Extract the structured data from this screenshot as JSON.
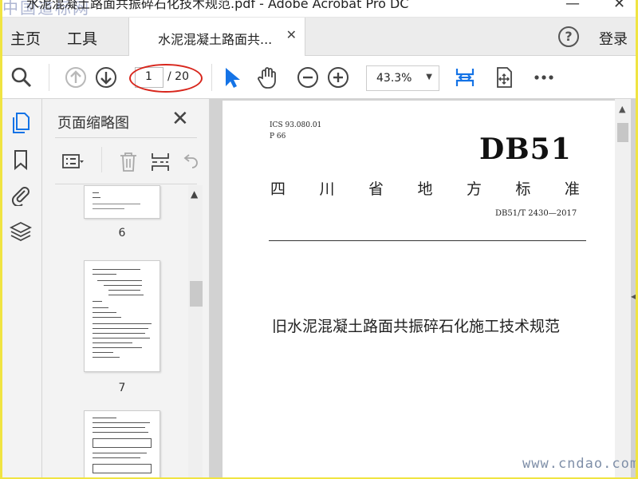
{
  "titlebar": {
    "title": "水泥混凝土路面共振碎石化技术规范.pdf - Adobe Acrobat Pro DC",
    "site_watermark": "中国道标网",
    "minimize_glyph": "—",
    "close_glyph": "✕"
  },
  "nav": {
    "home": "主页",
    "tools": "工具",
    "doc_tab_label": "水泥混凝土路面共...",
    "doc_tab_close": "✕",
    "help_glyph": "?",
    "login": "登录"
  },
  "toolbar": {
    "current_page": "1",
    "page_total": "/ 20",
    "zoom": "43.3%",
    "zoom_caret": "▼",
    "icons": [
      "search-icon",
      "page-up-icon",
      "page-down-icon",
      "select-cursor-icon",
      "hand-icon",
      "zoom-out-icon",
      "zoom-in-icon",
      "fit-page-icon",
      "rotate-view-icon",
      "more-icon"
    ],
    "accent_color": "#1473e6"
  },
  "rail": {
    "icons": [
      "page-thumbnails-icon",
      "bookmark-icon",
      "attachment-icon",
      "layers-icon"
    ]
  },
  "thumbnail_panel": {
    "title": "页面缩略图",
    "close_glyph": "✕",
    "tools": [
      "thumbnail-options-icon",
      "delete-page-icon",
      "insert-page-icon",
      "undo-icon"
    ],
    "thumbnails": [
      {
        "label": "6"
      },
      {
        "label": "7"
      },
      {
        "label": ""
      }
    ]
  },
  "document": {
    "ics": "ICS 93.080.01",
    "p_code": "P 66",
    "db_code": "DB51",
    "province_standard": [
      "四",
      "川",
      "省",
      "地",
      "方",
      "标",
      "准"
    ],
    "standard_number": "DB51/T 2430—2017",
    "title": "旧水泥混凝土路面共振碎石化施工技术规范"
  },
  "watermark": "www.cndao.com",
  "colors": {
    "frame": "#f0e442",
    "annotation_ring": "#d8261c"
  }
}
